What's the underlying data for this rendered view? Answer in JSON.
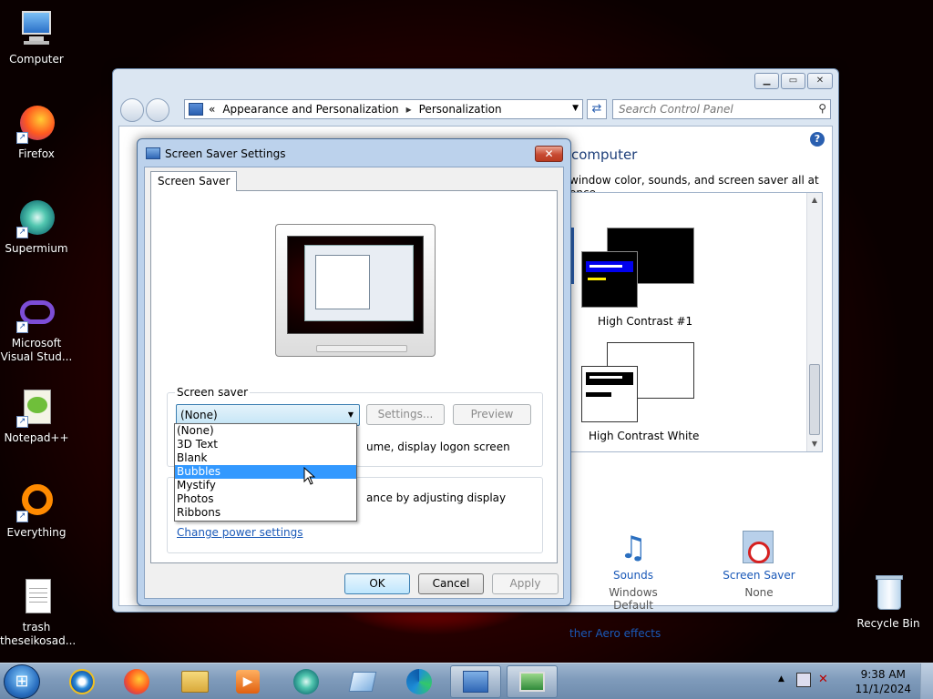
{
  "desktop": {
    "icons": [
      {
        "label": "Computer"
      },
      {
        "label": "Firefox"
      },
      {
        "label": "Supermium"
      },
      {
        "label": "Microsoft Visual Stud..."
      },
      {
        "label": "Notepad++"
      },
      {
        "label": "Everything"
      },
      {
        "label": "trash theseikosad..."
      },
      {
        "label": "Recycle Bin"
      }
    ]
  },
  "control_panel": {
    "breadcrumb": {
      "prefix": "«",
      "level1": "Appearance and Personalization",
      "level2": "Personalization"
    },
    "search_placeholder": "Search Control Panel",
    "heading": "computer",
    "description": "window color, sounds, and screen saver all at once.",
    "themes": [
      {
        "name": "High Contrast #1"
      },
      {
        "name": "High Contrast White"
      }
    ],
    "bottom_items": [
      {
        "label": "Sounds",
        "sub": "Windows Default",
        "icon": "music-notes-icon"
      },
      {
        "label": "Screen Saver",
        "sub": "None",
        "icon": "screen-saver-none-icon"
      }
    ],
    "aero_link": "ther Aero effects"
  },
  "dialog": {
    "title": "Screen Saver Settings",
    "close_glyph": "✕",
    "tab_label": "Screen Saver",
    "group_screen_saver": "Screen saver",
    "selected_value": "(None)",
    "settings_button": "Settings...",
    "preview_button": "Preview",
    "resume_text": "ume, display logon screen",
    "power_text": "ance by adjusting display",
    "power_link": "Change power settings",
    "ok_button": "OK",
    "cancel_button": "Cancel",
    "apply_button": "Apply",
    "options": [
      "(None)",
      "3D Text",
      "Blank",
      "Bubbles",
      "Mystify",
      "Photos",
      "Ribbons"
    ],
    "highlighted_option": "Bubbles"
  },
  "taskbar": {
    "clock_time": "9:38 AM",
    "clock_date": "11/1/2024",
    "tray_arrow": "▲"
  },
  "colors": {
    "accent_blue": "#3399ff",
    "link_blue": "#1a59b8",
    "close_red": "#c84a32"
  }
}
